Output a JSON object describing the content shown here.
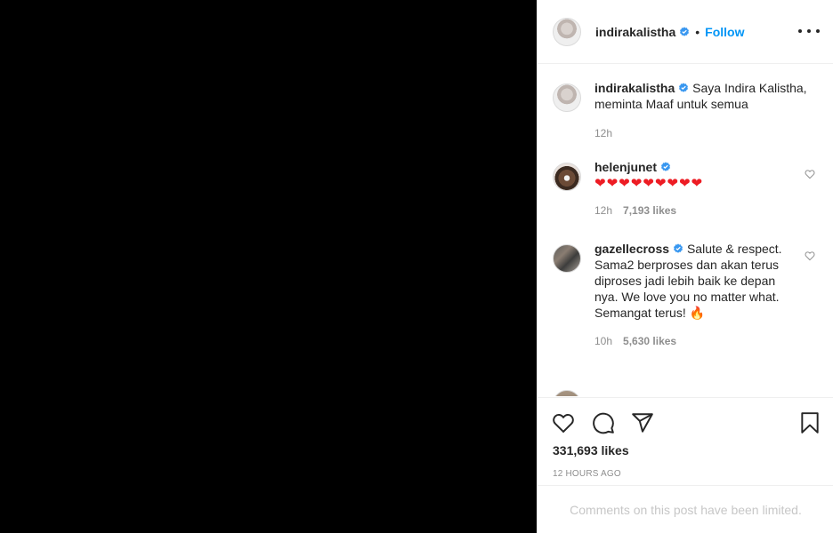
{
  "post": {
    "author": "indirakalistha",
    "follow_label": "Follow",
    "separator": "•"
  },
  "comments": [
    {
      "username": "indirakalistha",
      "verified": true,
      "text": "Saya Indira Kalistha, meminta Maaf untuk semua",
      "time": "12h",
      "likes": ""
    },
    {
      "username": "helenjunet",
      "verified": true,
      "text": "❤❤❤❤❤❤❤❤❤",
      "time": "12h",
      "likes": "7,193 likes"
    },
    {
      "username": "gazellecross",
      "verified": true,
      "text": "Salute & respect. Sama2 berproses dan akan terus diproses jadi lebih baik ke depan nya. We love you no matter what. Semangat terus!",
      "emoji": "🔥",
      "time": "10h",
      "likes": "5,630 likes"
    }
  ],
  "likes_count": "331,693 likes",
  "time_ago": "12 HOURS AGO",
  "comments_limited": "Comments on this post have been limited.",
  "icons": {
    "like": "heart-icon",
    "comment": "comment-icon",
    "share": "paper-plane-icon",
    "save": "bookmark-icon",
    "more": "more-options-icon",
    "verified": "verified-badge-icon"
  },
  "colors": {
    "link": "#0095f6",
    "verified": "#3897f0",
    "text": "#262626",
    "muted": "#8e8e8e"
  }
}
